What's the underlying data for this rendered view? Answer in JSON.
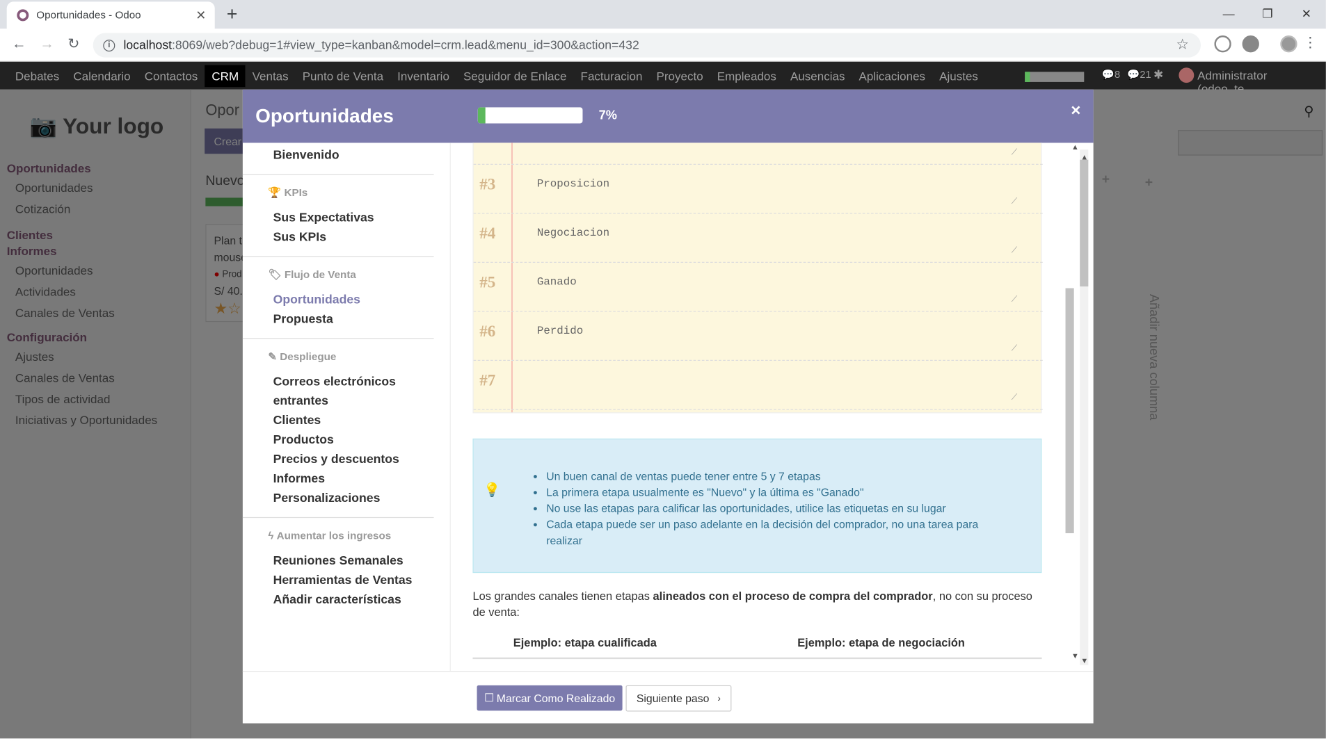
{
  "browser": {
    "tab_title": "Oportunidades - Odoo",
    "url_host": "localhost",
    "url_path": ":8069/web?debug=1#view_type=kanban&model=crm.lead&menu_id=300&action=432"
  },
  "topmenu": [
    "Debates",
    "Calendario",
    "Contactos",
    "CRM",
    "Ventas",
    "Punto de Venta",
    "Inventario",
    "Seguidor de Enlace",
    "Facturacion",
    "Proyecto",
    "Empleados",
    "Ausencias",
    "Aplicaciones",
    "Ajustes"
  ],
  "topbar": {
    "user": "Administrator (odoo_te...",
    "badge1": "8",
    "badge2": "21"
  },
  "sidebar": {
    "logo": "Your logo",
    "groups": [
      {
        "title": "Oportunidades",
        "items": [
          "Oportunidades",
          "Cotización"
        ]
      },
      {
        "title": "Clientes",
        "items": []
      },
      {
        "title": "Informes",
        "items": [
          "Oportunidades",
          "Actividades",
          "Canales de Ventas"
        ]
      },
      {
        "title": "Configuración",
        "items": [
          "Ajustes",
          "Canales de Ventas",
          "Tipos de actividad",
          "Iniciativas y Oportunidades"
        ]
      }
    ]
  },
  "modal": {
    "title": "Oportunidades",
    "progress_pct": 7,
    "progress_label": "7%",
    "close": "×",
    "nav": [
      {
        "title": "",
        "items": [
          "Bienvenido"
        ]
      },
      {
        "title": "KPIs",
        "icon": "trophy-icon",
        "items": [
          "Sus Expectativas",
          "Sus KPIs"
        ]
      },
      {
        "title": "Flujo de Venta",
        "icon": "tag-icon",
        "items": [
          "Oportunidades",
          "Propuesta"
        ]
      },
      {
        "title": "Despliegue",
        "icon": "magic-icon",
        "items": [
          "Correos electrónicos entrantes",
          "Clientes",
          "Productos",
          "Precios y descuentos",
          "Informes",
          "Personalizaciones"
        ]
      },
      {
        "title": "Aumentar los ingresos",
        "icon": "bolt-icon",
        "items": [
          "Reuniones Semanales",
          "Herramientas de Ventas",
          "Añadir características"
        ]
      }
    ],
    "stages": [
      {
        "num": "#3",
        "value": "Proposicion"
      },
      {
        "num": "#4",
        "value": "Negociacion"
      },
      {
        "num": "#5",
        "value": "Ganado"
      },
      {
        "num": "#6",
        "value": "Perdido"
      },
      {
        "num": "#7",
        "value": ""
      }
    ],
    "tips": [
      "Un buen canal de ventas puede tener entre 5 y 7 etapas",
      "La primera etapa usualmente es \"Nuevo\" y la última es \"Ganado\"",
      "No use las etapas para calificar las oportunidades, utilice las etiquetas en su lugar",
      "Cada etapa puede ser un paso adelante en la decisión del comprador, no una tarea para realizar"
    ],
    "para_pre": "Los grandes canales tienen etapas ",
    "para_bold": "alineados con el proceso de compra del comprador",
    "para_post": ", no con su proceso de venta:",
    "col1": "Ejemplo: etapa cualificada",
    "col2": "Ejemplo: etapa de negociación",
    "btn_done": "Marcar Como Realizado",
    "btn_next": "Siguiente paso"
  },
  "background": {
    "breadcrumb": "Opor",
    "create": "Crear",
    "column": "Nuevo",
    "card_title": "Plan t",
    "card_sub": "mouse",
    "card_tag": "Prod",
    "card_price": "S/ 40.",
    "add_column": "Añadir nueva columna"
  }
}
